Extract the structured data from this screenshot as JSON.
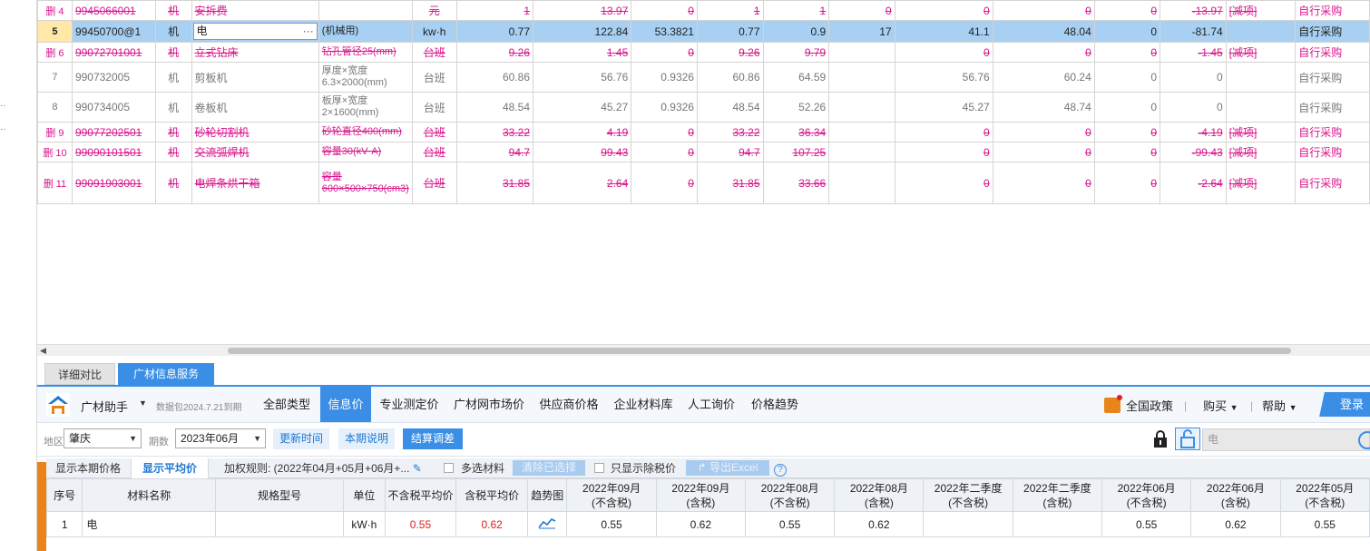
{
  "upper_rows": [
    {
      "idx": "4",
      "deleted": true,
      "code": "9945066001",
      "type": "机",
      "name": "安拆费",
      "spec": "",
      "unit": "元",
      "c1": "1",
      "c2": "13.97",
      "c3": "0",
      "c4": "1",
      "c5": "1",
      "c6": "0",
      "c7": "0",
      "c8": "0",
      "c9": "0",
      "c10": "-13.97",
      "flag": "[减项]",
      "source": "自行采购"
    },
    {
      "idx": "5",
      "deleted": false,
      "selected": true,
      "code": "99450700@1",
      "type": "机",
      "name": "电",
      "spec": "(机械用)",
      "unit": "kw·h",
      "c1": "0.77",
      "c2": "122.84",
      "c3": "53.3821",
      "c4": "0.77",
      "c5": "0.9",
      "c6": "17",
      "c7": "41.1",
      "c8": "48.04",
      "c9": "0",
      "c10": "-81.74",
      "flag": "",
      "source": "自行采购"
    },
    {
      "idx": "6",
      "deleted": true,
      "code": "99072701001",
      "type": "机",
      "name": "立式钻床",
      "spec": "钻孔管径25(mm)",
      "unit": "台班",
      "c1": "9.26",
      "c2": "1.45",
      "c3": "0",
      "c4": "9.26",
      "c5": "9.79",
      "c6": "",
      "c7": "0",
      "c8": "0",
      "c9": "0",
      "c10": "-1.45",
      "flag": "[减项]",
      "source": "自行采购"
    },
    {
      "idx": "7",
      "deleted": false,
      "code": "990732005",
      "type": "机",
      "name": "剪板机",
      "spec": "厚度×宽度 6.3×2000(mm)",
      "unit": "台班",
      "c1": "60.86",
      "c2": "56.76",
      "c3": "0.9326",
      "c4": "60.86",
      "c5": "64.59",
      "c6": "",
      "c7": "56.76",
      "c8": "60.24",
      "c9": "0",
      "c10": "0",
      "flag": "",
      "source": "自行采购"
    },
    {
      "idx": "8",
      "deleted": false,
      "code": "990734005",
      "type": "机",
      "name": "卷板机",
      "spec": "板厚×宽度 2×1600(mm)",
      "unit": "台班",
      "c1": "48.54",
      "c2": "45.27",
      "c3": "0.9326",
      "c4": "48.54",
      "c5": "52.26",
      "c6": "",
      "c7": "45.27",
      "c8": "48.74",
      "c9": "0",
      "c10": "0",
      "flag": "",
      "source": "自行采购"
    },
    {
      "idx": "9",
      "deleted": true,
      "code": "99077202501",
      "type": "机",
      "name": "砂轮切割机",
      "spec": "砂轮直径400(mm)",
      "unit": "台班",
      "c1": "33.22",
      "c2": "4.19",
      "c3": "0",
      "c4": "33.22",
      "c5": "36.34",
      "c6": "",
      "c7": "0",
      "c8": "0",
      "c9": "0",
      "c10": "-4.19",
      "flag": "[减项]",
      "source": "自行采购"
    },
    {
      "idx": "10",
      "deleted": true,
      "code": "99090101501",
      "type": "机",
      "name": "交流弧焊机",
      "spec": "容量30(kV·A)",
      "unit": "台班",
      "c1": "94.7",
      "c2": "99.43",
      "c3": "0",
      "c4": "94.7",
      "c5": "107.25",
      "c6": "",
      "c7": "0",
      "c8": "0",
      "c9": "0",
      "c10": "-99.43",
      "flag": "[减项]",
      "source": "自行采购"
    },
    {
      "idx": "11",
      "deleted": true,
      "code": "99091903001",
      "type": "机",
      "name": "电焊条烘干箱",
      "spec": "容量 600×500×750(cm3)",
      "unit": "台班",
      "c1": "31.85",
      "c2": "2.64",
      "c3": "0",
      "c4": "31.85",
      "c5": "33.66",
      "c6": "",
      "c7": "0",
      "c8": "0",
      "c9": "0",
      "c10": "-2.64",
      "flag": "[减项]",
      "source": "自行采购"
    }
  ],
  "del_label": "删",
  "edit_ellipsis": "···",
  "bottom_tabs": {
    "detail": "详细对比",
    "gc": "广材信息服务"
  },
  "toolbar": {
    "brand": "广材助手",
    "data_pkg": "数据包2024.7.21到期",
    "nav": [
      "全部类型",
      "信息价",
      "专业测定价",
      "广材网市场价",
      "供应商价格",
      "企业材料库",
      "人工询价",
      "价格趋势"
    ],
    "policy": "全国政策",
    "buy": "购买",
    "help": "帮助",
    "login": "登录"
  },
  "filter": {
    "region_label": "地区",
    "region_value": "肇庆",
    "period_label": "期数",
    "period_value": "2023年06月",
    "update_time": "更新时间",
    "period_desc": "本期说明",
    "settle_adjust": "结算调差",
    "search_value": "电"
  },
  "subbar": {
    "show_current": "显示本期价格",
    "show_avg": "显示平均价",
    "weight_rule": "加权规则: (2022年04月+05月+06月+...",
    "multi_select": "多选材料",
    "clear_selected": "清除已选择",
    "only_ex_tax": "只显示除税价",
    "export_excel": "导出Excel"
  },
  "lower_headers": [
    "序号",
    "材料名称",
    "规格型号",
    "单位",
    "不含税平均价",
    "含税平均价",
    "趋势图",
    "2022年09月\n(不含税)",
    "2022年09月\n(含税)",
    "2022年08月\n(不含税)",
    "2022年08月\n(含税)",
    "2022年二季度\n(不含税)",
    "2022年二季度\n(含税)",
    "2022年06月\n(不含税)",
    "2022年06月\n(含税)",
    "2022年05月\n(不含税)"
  ],
  "lower_rows": [
    {
      "idx": "1",
      "name": "电",
      "spec": "",
      "unit": "kW·h",
      "avg_ex": "0.55",
      "avg_in": "0.62",
      "m1": "0.55",
      "m2": "0.62",
      "m3": "0.55",
      "m4": "0.62",
      "m5": "",
      "m6": "",
      "m7": "0.55",
      "m8": "0.62",
      "m9": "0.55"
    }
  ],
  "colors": {
    "accent": "#3a8ee6",
    "deleted": "#d8168c",
    "selected_row": "#a8d0f3",
    "price_red": "#e02020"
  }
}
